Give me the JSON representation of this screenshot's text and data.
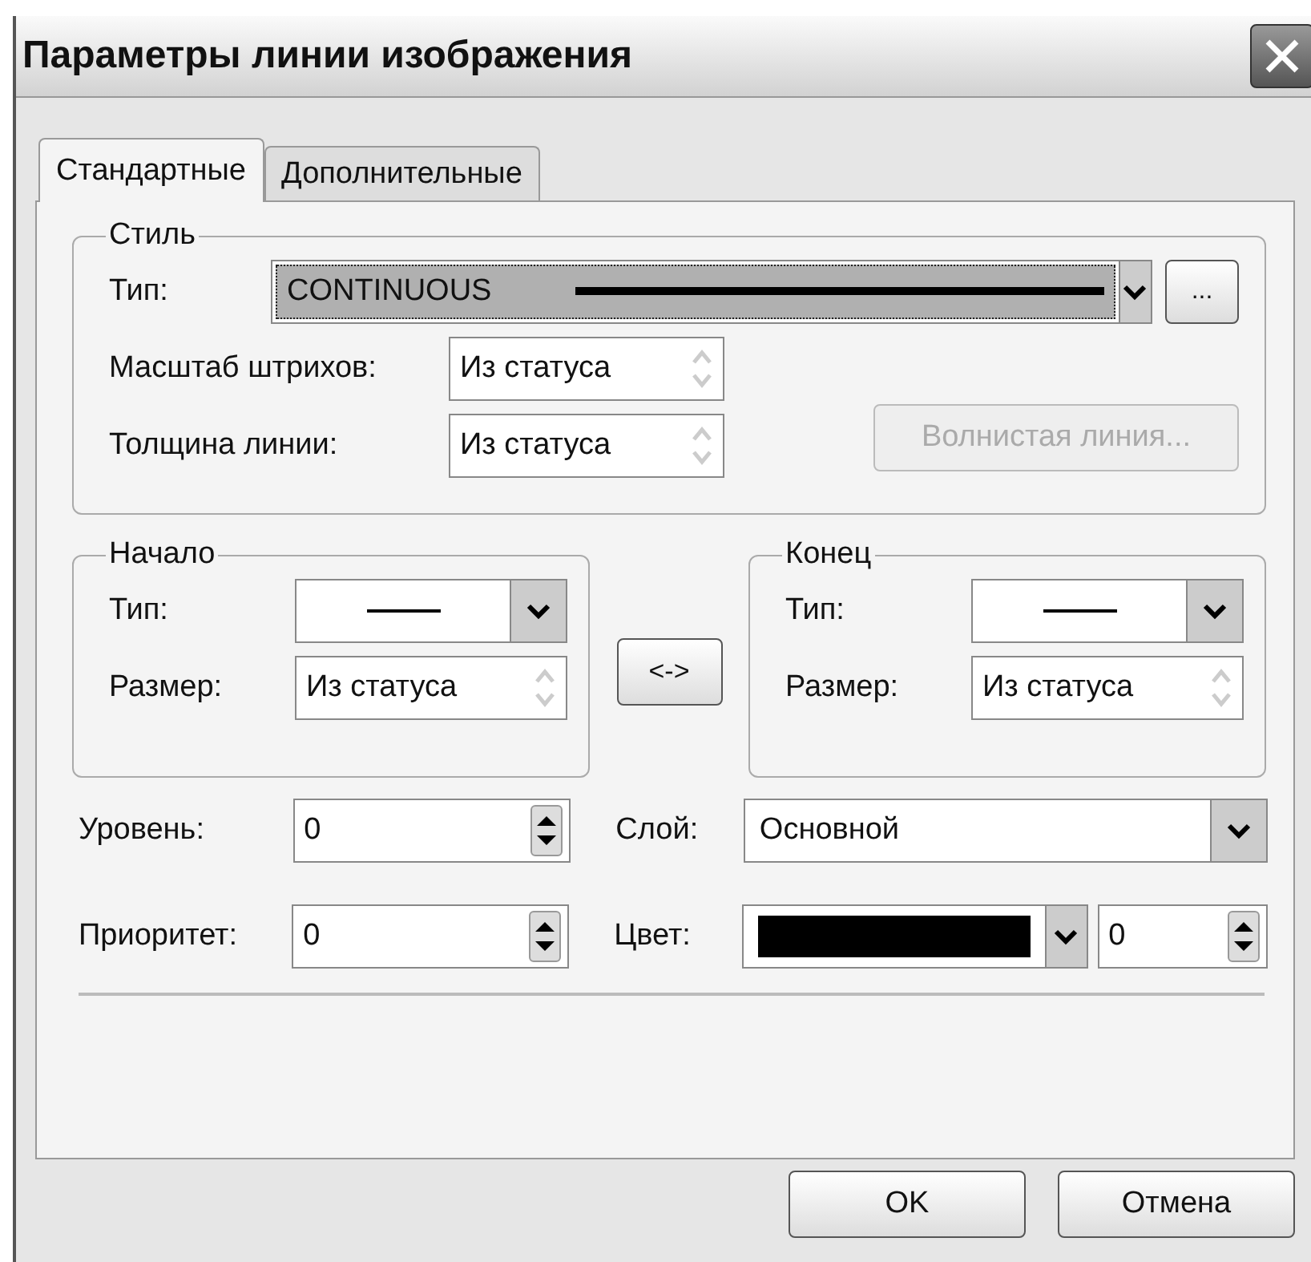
{
  "window": {
    "title": "Параметры линии изображения"
  },
  "tabs": [
    {
      "label": "Стандартные",
      "selected": true
    },
    {
      "label": "Дополнительные",
      "selected": false
    }
  ],
  "style_group": {
    "title": "Стиль",
    "type": {
      "label": "Тип:",
      "value": "CONTINUOUS",
      "focused": true
    },
    "more_button": "...",
    "fields": [
      {
        "label": "Масштаб штрихов:",
        "value": "Из статуса",
        "spinner_disabled": true
      },
      {
        "label": "Толщина линии:",
        "value": "Из статуса",
        "spinner_disabled": true
      }
    ],
    "wavy_button": {
      "label": "Волнистая линия...",
      "disabled": true
    }
  },
  "ends": [
    {
      "title": "Начало",
      "type_label": "Тип:",
      "size_label": "Размер:",
      "size_value": "Из статуса",
      "spinner_disabled": true
    },
    {
      "title": "Конец",
      "type_label": "Тип:",
      "size_label": "Размер:",
      "size_value": "Из статуса",
      "spinner_disabled": true
    }
  ],
  "swap_button": "<->",
  "level": {
    "label": "Уровень:",
    "value": "0"
  },
  "layer": {
    "label": "Слой:",
    "value": "Основной"
  },
  "priority": {
    "label": "Приоритет:",
    "value": "0"
  },
  "color": {
    "label": "Цвет:",
    "color": "#000000",
    "number": "0"
  },
  "buttons": [
    "OK",
    "Отмена"
  ]
}
